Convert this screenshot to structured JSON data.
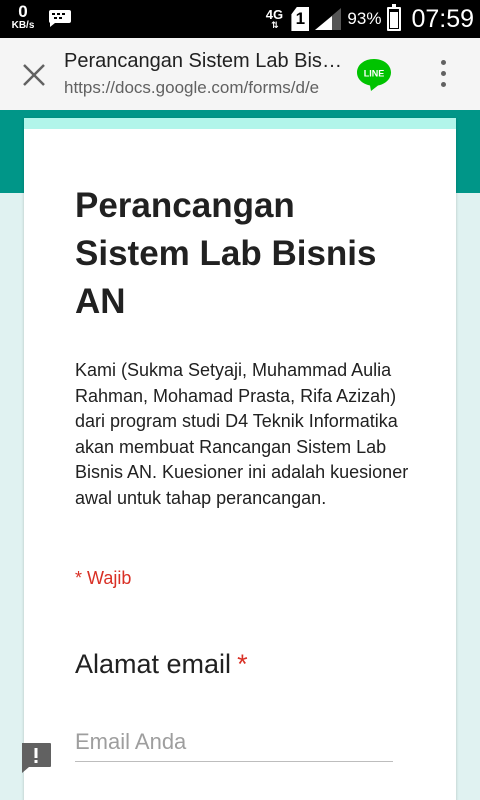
{
  "status_bar": {
    "speed_value": "0",
    "speed_unit": "KB/s",
    "network": "4G",
    "sim_slot": "1",
    "battery": "93%",
    "time": "07:59"
  },
  "browser": {
    "title": "Perancangan Sistem Lab Bisnis AN",
    "url": "https://docs.google.com/forms/d/e",
    "line_label": "LINE"
  },
  "form": {
    "title": "Perancangan Sistem Lab Bisnis AN",
    "description": "Kami (Sukma Setyaji, Muhammad Aulia Rahman, Mohamad Prasta, Rifa Azizah) dari program studi D4 Teknik Informatika akan membuat Rancangan Sistem Lab Bisnis AN. Kuesioner ini adalah kuesioner awal untuk tahap perancangan.",
    "required_note": "* Wajib",
    "questions": [
      {
        "label": "Alamat email",
        "required_mark": "*",
        "placeholder": "Email Anda",
        "value": ""
      }
    ]
  },
  "colors": {
    "theme": "#009688",
    "background": "#e0f2f1",
    "accent_stripe": "#b2f5ea",
    "required": "#d93025",
    "line_green": "#00c300"
  }
}
